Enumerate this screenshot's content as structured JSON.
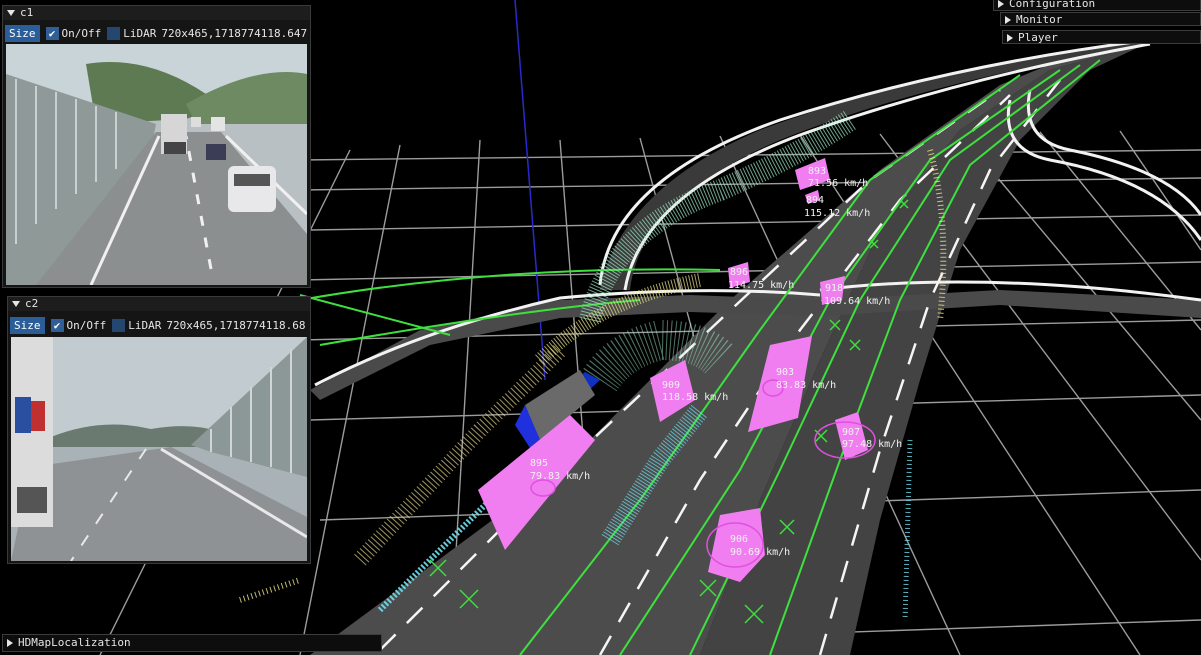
{
  "camera_panels": [
    {
      "title": "c1",
      "size_label": "Size",
      "onoff_label": "On/Off",
      "lidar_label": "LiDAR",
      "info": "720x465,1718774118.647"
    },
    {
      "title": "c2",
      "size_label": "Size",
      "onoff_label": "On/Off",
      "lidar_label": "LiDAR",
      "info": "720x465,1718774118.68"
    }
  ],
  "menus": {
    "configuration": "Configuration",
    "monitor": "Monitor",
    "player": "Player",
    "hdmap": "HDMapLocalization"
  },
  "tracked_objects": [
    {
      "id": "893",
      "speed": "71.56 km/h"
    },
    {
      "id": "894",
      "speed": "115.12 km/h"
    },
    {
      "id": "896",
      "speed": "114.75 km/h"
    },
    {
      "id": "918",
      "speed": "109.64 km/h"
    },
    {
      "id": "909",
      "speed": "118.58 km/h"
    },
    {
      "id": "903",
      "speed": "83.83 km/h"
    },
    {
      "id": "907",
      "speed": "97.48 km/h"
    },
    {
      "id": "895",
      "speed": "79.83 km/h"
    },
    {
      "id": "906",
      "speed": "90.69 km/h"
    }
  ],
  "colors": {
    "object_box": "#f07ef0",
    "lane_marker": "#3ee03e",
    "road": "#4a4a4a",
    "ego_vehicle": "#1030c0",
    "panel_button": "#2b5d99"
  }
}
